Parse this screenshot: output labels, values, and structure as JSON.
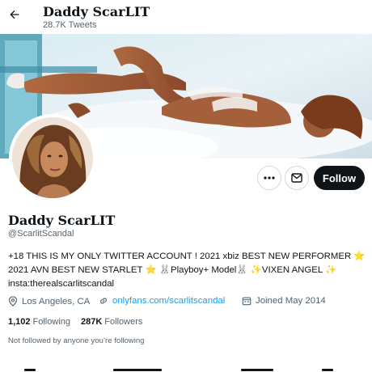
{
  "header": {
    "name": "Daddy ScarLIT",
    "tweet_count": "28.7K Tweets"
  },
  "profile": {
    "display_name": "Daddy ScarLIT",
    "handle": "@ScarlitScandal",
    "bio_lines": [
      "+18 THIS IS MY ONLY TWITTER ACCOUNT ! 2021 xbiz BEST NEW PERFORMER ⭐",
      "2021 AVN BEST NEW STARLET ⭐ 🐰Playboy+ Model🐰 ✨VIXEN ANGEL ✨",
      "insta:therealscarlitscandal"
    ],
    "location": "Los Angeles, CA",
    "website": "onlyfans.com/scarlitscandal",
    "joined": "Joined May 2014",
    "following_count": "1,102",
    "following_label": "Following",
    "followers_count": "287K",
    "followers_label": "Followers",
    "not_followed_text": "Not followed by anyone you’re following"
  },
  "actions": {
    "follow_label": "Follow"
  },
  "colors": {
    "accent": "#1d9bf0",
    "text": "#0f1419",
    "secondary": "#536471"
  }
}
